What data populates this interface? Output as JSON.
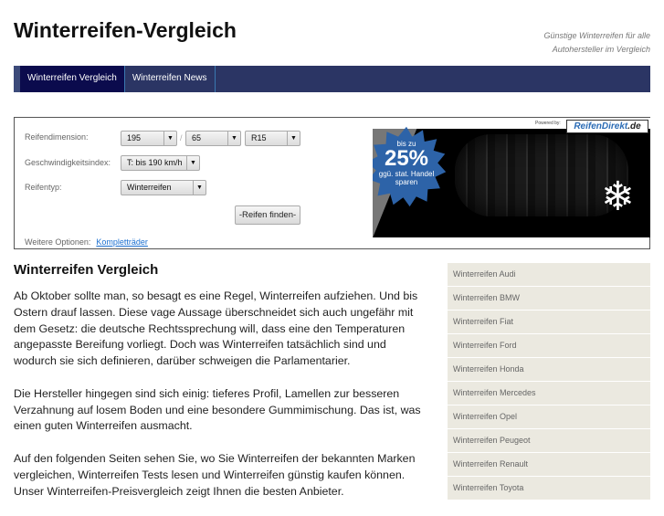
{
  "header": {
    "title": "Winterreifen-Vergleich",
    "tagline_line1": "Günstige Winterreifen für alle",
    "tagline_line2": "Autohersteller im Vergleich"
  },
  "nav": [
    {
      "label": "Winterreifen Vergleich",
      "active": true
    },
    {
      "label": "Winterreifen News",
      "active": false
    }
  ],
  "form": {
    "dimension_label": "Reifendimension:",
    "width": "195",
    "height": "65",
    "rim": "R15",
    "separator": "/",
    "speed_label": "Geschwindigkeitsindex:",
    "speed": "T: bis 190 km/h",
    "type_label": "Reifentyp:",
    "type": "Winterreifen",
    "submit": "-Reifen finden-",
    "more_label": "Weitere Optionen:",
    "more_link": "Kompletträder",
    "arrow": "▼"
  },
  "banner": {
    "powered": "Powered by:",
    "logo_main": "ReifenDirekt",
    "logo_tld": ".de",
    "badge_line1": "bis zu",
    "badge_big": "25%",
    "badge_line2": "ggü. stat. Handel",
    "badge_line3": "sparen",
    "snowflake": "❄"
  },
  "main": {
    "heading": "Winterreifen Vergleich",
    "paragraphs": [
      "Ab Oktober sollte man, so besagt es eine Regel, Winterreifen aufziehen. Und bis Ostern drauf lassen. Diese vage Aussage überschneidet sich auch ungefähr mit dem Gesetz: die deutsche Rechtssprechung will, dass eine den Temperaturen angepasste Bereifung vorliegt. Doch was Winterreifen tatsächlich sind und wodurch sie sich definieren, darüber schweigen die Parlamentarier.",
      "Die Hersteller hingegen sind sich einig: tieferes Profil, Lamellen zur besseren Verzahnung auf losem Boden und eine besondere Gummimischung. Das ist, was einen guten Winterreifen ausmacht.",
      "Auf den folgenden Seiten sehen Sie, wo Sie Winterreifen der bekannten Marken vergleichen, Winterreifen Tests lesen und Winterreifen günstig kaufen können. Unser Winterreifen-Preisvergleich zeigt Ihnen die besten Anbieter."
    ]
  },
  "sidebar": [
    "Winterreifen Audi",
    "Winterreifen BMW",
    "Winterreifen Fiat",
    "Winterreifen Ford",
    "Winterreifen Honda",
    "Winterreifen Mercedes",
    "Winterreifen Opel",
    "Winterreifen Peugeot",
    "Winterreifen Renault",
    "Winterreifen Toyota"
  ]
}
